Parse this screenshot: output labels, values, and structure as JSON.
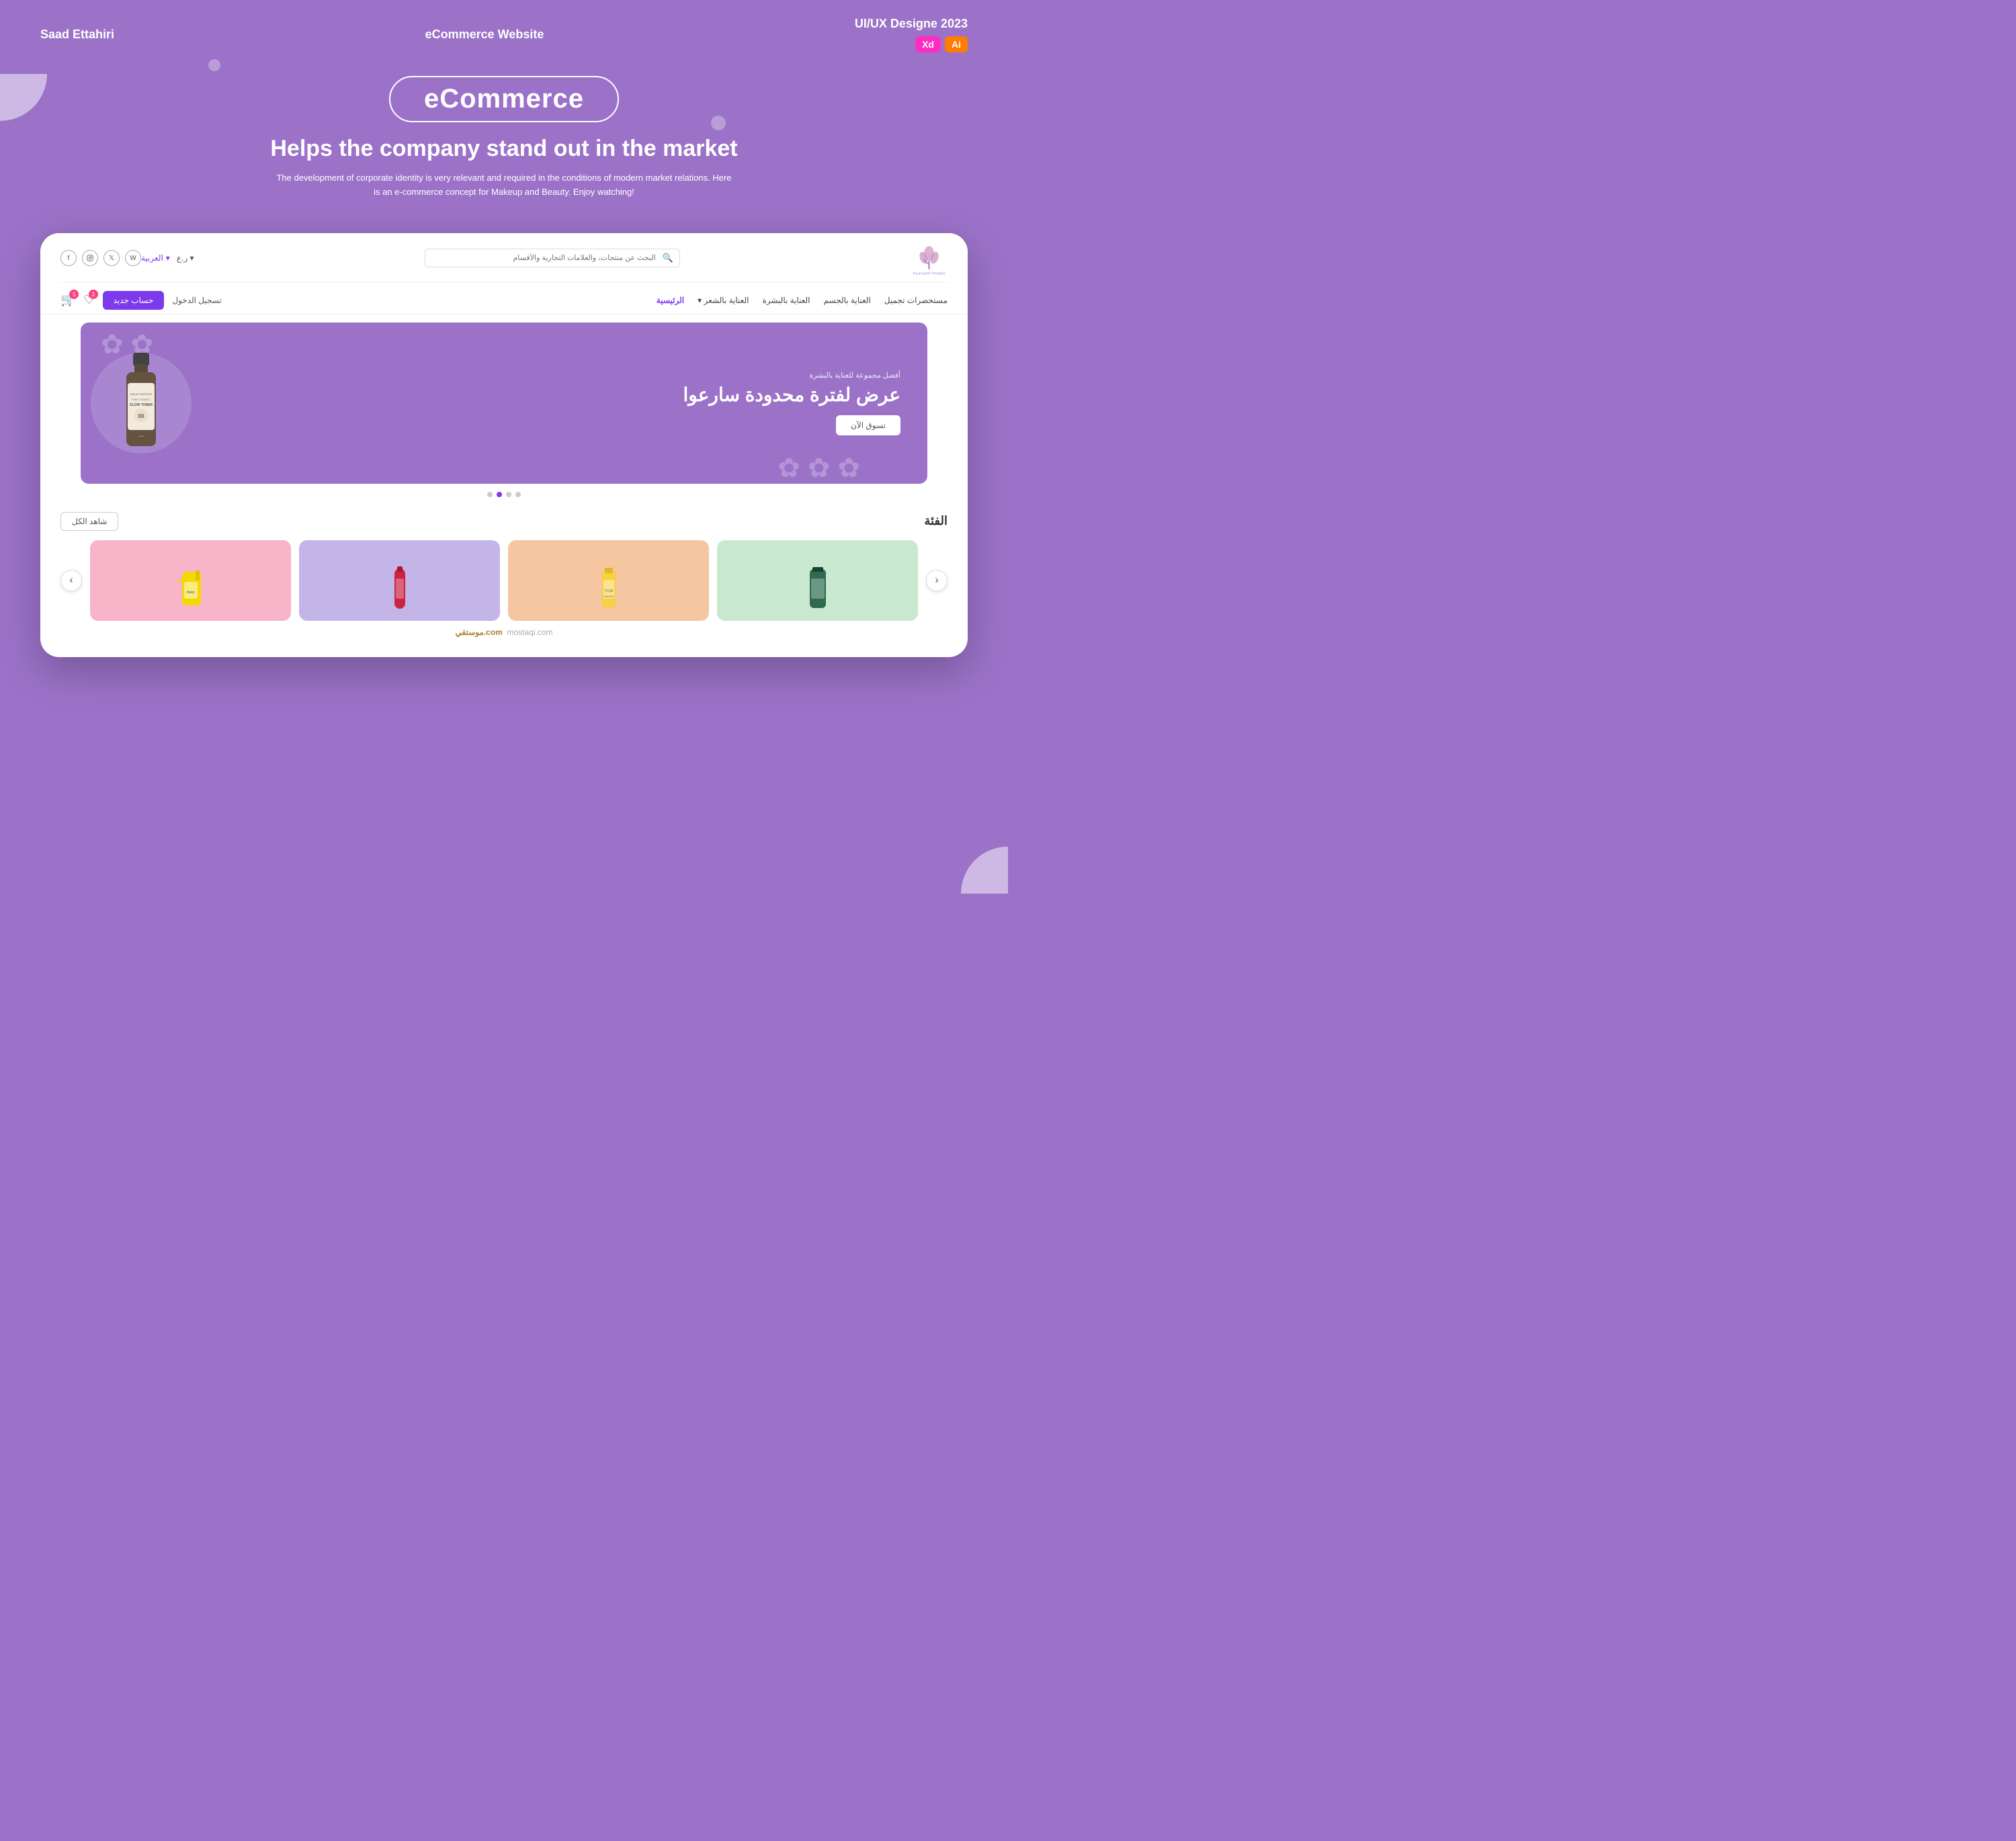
{
  "meta": {
    "author": "Saad Ettahiri",
    "project": "eCommerce Website",
    "year": "UI/UX Designe 2023",
    "badge_xd": "Xd",
    "badge_ai": "Ai"
  },
  "hero": {
    "brand_name": "eCommerce",
    "tagline": "Helps the company stand out in the market",
    "description": "The development of corporate identity is very relevant and required in the conditions of modern market relations. Here is an e-commerce concept for Makeup and Beauty. Enjoy watching!"
  },
  "website": {
    "logo_alt": "Tulip Mart Trading",
    "search_placeholder": "البحث عن منتجات، والعلامات التجارية والأقسام",
    "nav": {
      "home": "الرئيسية",
      "hair_care": "العناية بالشعر",
      "skin_care": "العناية بالبشرة",
      "body_care": "العناية بالجسم",
      "cosmetics": "مستحضرات تجميل"
    },
    "top_bar": {
      "language": "العربية",
      "currency": "ر.ع",
      "login": "تسجيل الدخول",
      "register": "حساب جديد"
    },
    "banner": {
      "subtitle": "أفضل مجموعة للعناية بالبشرة",
      "title": "عرض لفترة محدودة سارعوا",
      "cta": "تسوق الآن"
    },
    "category": {
      "title": "الفئة",
      "see_all": "شاهد الكل"
    },
    "dots": [
      "1",
      "2",
      "3",
      "4"
    ],
    "active_dot": 1
  },
  "colors": {
    "bg_purple": "#9b72c8",
    "accent_purple": "#7c3aed",
    "white": "#ffffff"
  }
}
